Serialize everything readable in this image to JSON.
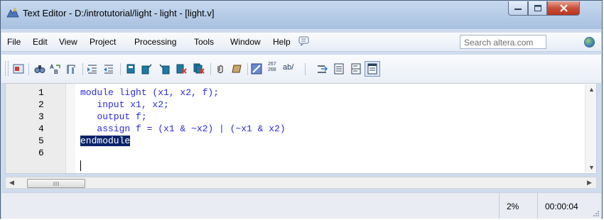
{
  "window": {
    "title": "Text Editor - D:/introtutorial/light - light - [light.v]"
  },
  "menu": {
    "items": [
      "File",
      "Edit",
      "View",
      "Project",
      "Processing",
      "Tools",
      "Window",
      "Help"
    ],
    "search_placeholder": "Search altera.com"
  },
  "toolbar": {
    "lines_label": "267\n268",
    "ab_label": "ab/"
  },
  "editor": {
    "line_numbers": [
      "1",
      "2",
      "3",
      "4",
      "5",
      "6"
    ],
    "lines": [
      "module light (x1, x2, f);",
      "   input x1, x2;",
      "   output f;",
      "   assign f = (x1 & ~x2) | (~x1 & x2)",
      "endmodule",
      ""
    ],
    "selected_line": 5
  },
  "statusbar": {
    "zoom": "2%",
    "time": "00:00:04"
  },
  "colors": {
    "keyword": "#2a2ae0",
    "selection": "#0a246a",
    "close_button": "#c7503b"
  }
}
